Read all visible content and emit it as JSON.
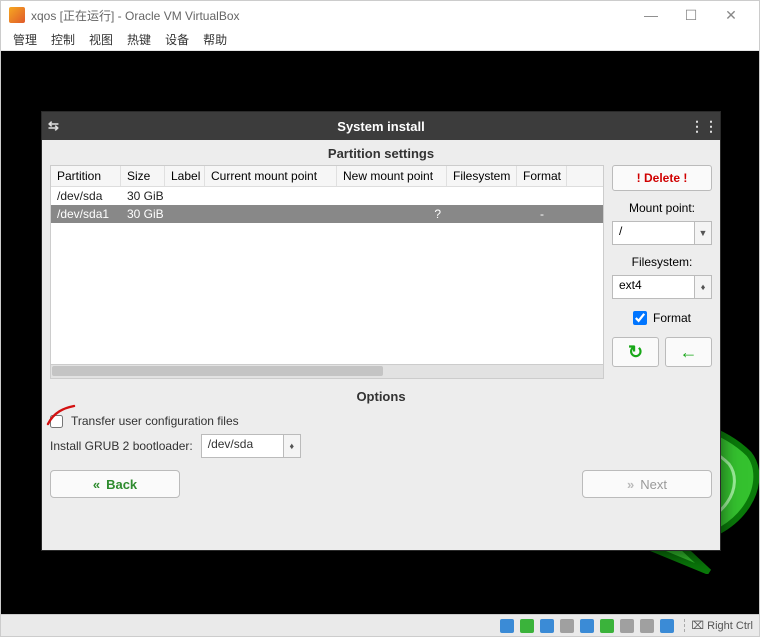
{
  "vb": {
    "title": "xqos [正在运行] - Oracle VM VirtualBox",
    "menus": [
      "管理",
      "控制",
      "视图",
      "热键",
      "设备",
      "帮助"
    ],
    "win_buttons": {
      "min": "—",
      "max": "☐",
      "close": "✕"
    },
    "status_host_key": "Right Ctrl"
  },
  "installer": {
    "title": "System install",
    "partition_settings_title": "Partition settings",
    "columns": [
      "Partition",
      "Size",
      "Label",
      "Current mount point",
      "New mount point",
      "Filesystem",
      "Format"
    ],
    "rows": [
      {
        "partition": "/dev/sda",
        "size": "30 GiB",
        "label": "",
        "cur": "",
        "newm": "",
        "fs": "",
        "fmt": "",
        "kind": "device"
      },
      {
        "partition": "/dev/sda1",
        "size": "30 GiB",
        "label": "",
        "cur": "",
        "newm": "?",
        "fs": "",
        "fmt": "-",
        "kind": "selected"
      }
    ],
    "side": {
      "delete_label": "! Delete !",
      "mount_label": "Mount point:",
      "mount_value": "/",
      "fs_label": "Filesystem:",
      "fs_value": "ext4",
      "format_label": "Format",
      "format_checked": true
    },
    "options_title": "Options",
    "transfer_label": "Transfer user configuration files",
    "transfer_checked": false,
    "grub_label": "Install GRUB 2 bootloader:",
    "grub_value": "/dev/sda",
    "back_label": "Back",
    "next_label": "Next"
  }
}
